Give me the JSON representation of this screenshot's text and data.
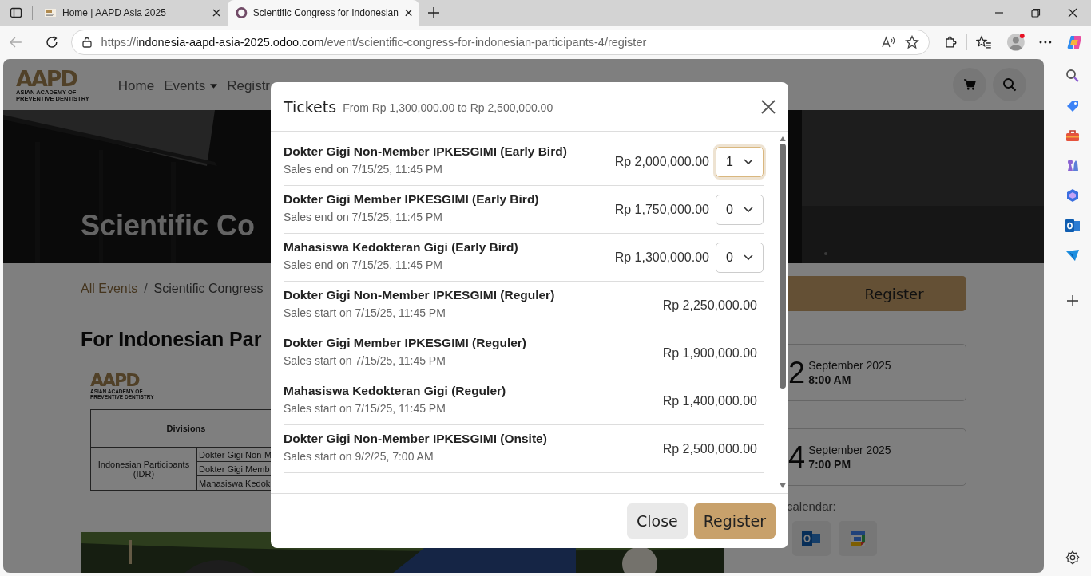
{
  "browser": {
    "tabs": [
      {
        "title": "Home | AAPD Asia 2025",
        "selected": false
      },
      {
        "title": "Scientific Congress for Indonesian",
        "selected": true
      }
    ],
    "url": {
      "scheme": "https://",
      "host": "indonesia-aapd-asia-2025.odoo.com",
      "path": "/event/scientific-congress-for-indonesian-participants-4/register"
    }
  },
  "site": {
    "logo": {
      "mark": "AAPD",
      "lines": [
        "ASIAN ACADEMY OF",
        "PREVENTIVE DENTISTRY"
      ]
    },
    "nav": [
      {
        "label": "Home",
        "dropdown": false
      },
      {
        "label": "Events",
        "dropdown": true
      },
      {
        "label": "Registr",
        "dropdown": false
      }
    ]
  },
  "hero": {
    "title": "Scientific Co"
  },
  "breadcrumb": {
    "separator": "/",
    "items": [
      "All Events",
      "Scientific Congress"
    ]
  },
  "heading": "For Indonesian Par",
  "poster": {
    "logo": {
      "mark": "AAPD",
      "lines": [
        "ASIAN ACADEMY OF",
        "PREVENTIVE DENTISTRY"
      ]
    },
    "header": "Divisions",
    "group": "Indonesian Participants (IDR)",
    "divisions": [
      "Dokter Gigi Non-M",
      "Dokter Gigi Memb",
      "Mahasiswa Kedok"
    ]
  },
  "aside": {
    "register": "Register",
    "dates": [
      {
        "day": "2",
        "month": "September 2025",
        "time": "8:00 AM"
      },
      {
        "day": "4",
        "month": "September 2025",
        "time": "7:00 PM"
      }
    ],
    "calendar_label": "calendar:"
  },
  "modal": {
    "title": "Tickets",
    "range": "From Rp 1,300,000.00 to Rp 2,500,000.00",
    "tickets": [
      {
        "kind": "select",
        "name": "Dokter Gigi Non-Member IPKESGIMI (Early Bird)",
        "sales": "Sales end on 7/15/25, 11:45 PM",
        "price": "Rp 2,000,000.00",
        "quantity": "1",
        "focused": true
      },
      {
        "kind": "select",
        "name": "Dokter Gigi Member IPKESGIMI (Early Bird)",
        "sales": "Sales end on 7/15/25, 11:45 PM",
        "price": "Rp 1,750,000.00",
        "quantity": "0",
        "focused": false
      },
      {
        "kind": "select",
        "name": "Mahasiswa Kedokteran Gigi (Early Bird)",
        "sales": "Sales end on 7/15/25, 11:45 PM",
        "price": "Rp 1,300,000.00",
        "quantity": "0",
        "focused": false
      },
      {
        "kind": "plain",
        "name": "Dokter Gigi Non-Member IPKESGIMI (Reguler)",
        "sales": "Sales start on 7/15/25, 11:45 PM",
        "price": "Rp 2,250,000.00"
      },
      {
        "kind": "plain",
        "name": "Dokter Gigi Member IPKESGIMI (Reguler)",
        "sales": "Sales start on 7/15/25, 11:45 PM",
        "price": "Rp 1,900,000.00"
      },
      {
        "kind": "plain",
        "name": "Mahasiswa Kedokteran Gigi (Reguler)",
        "sales": "Sales start on 7/15/25, 11:45 PM",
        "price": "Rp 1,400,000.00"
      },
      {
        "kind": "plain",
        "name": "Dokter Gigi Non-Member IPKESGIMI (Onsite)",
        "sales": "Sales start on 9/2/25, 7:00 AM",
        "price": "Rp 2,500,000.00"
      }
    ],
    "buttons": [
      "Close",
      "Register"
    ]
  }
}
